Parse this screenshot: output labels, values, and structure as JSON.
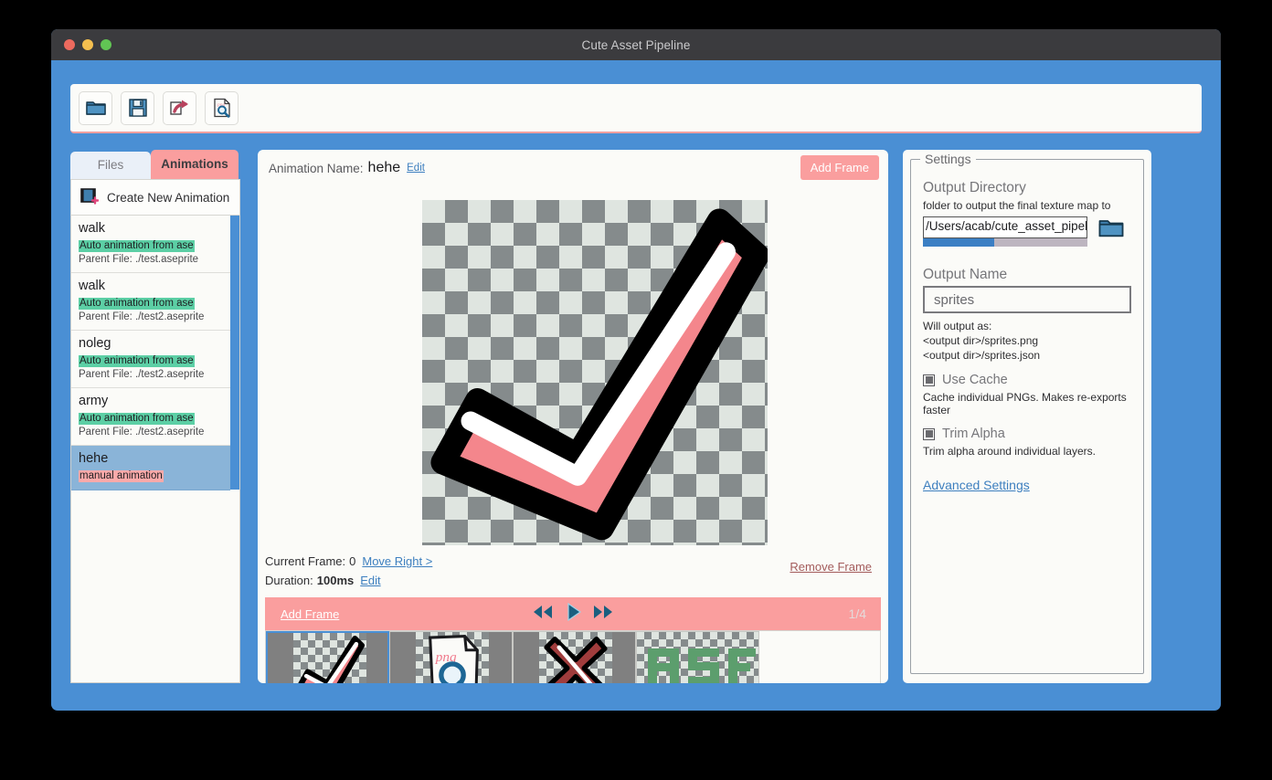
{
  "window": {
    "title": "Cute Asset Pipeline",
    "traffic_lights": [
      "close",
      "minimize",
      "maximize"
    ]
  },
  "toolbar": {
    "buttons": [
      {
        "name": "open-folder",
        "icon": "folder-icon"
      },
      {
        "name": "save",
        "icon": "floppy-disk-icon"
      },
      {
        "name": "export",
        "icon": "export-arrow-icon"
      },
      {
        "name": "preview-png",
        "icon": "png-search-icon"
      }
    ]
  },
  "sidebar": {
    "tabs": [
      {
        "label": "Files",
        "active": false
      },
      {
        "label": "Animations",
        "active": true
      }
    ],
    "create_new": {
      "label": "Create New Animation",
      "icon": "film-add-icon"
    },
    "animations": [
      {
        "name": "walk",
        "tag": "Auto animation from ase",
        "tag_type": "auto",
        "parent": "Parent File: ./test.aseprite",
        "selected": false
      },
      {
        "name": "walk",
        "tag": "Auto animation from ase",
        "tag_type": "auto",
        "parent": "Parent File: ./test2.aseprite",
        "selected": false
      },
      {
        "name": "noleg",
        "tag": "Auto animation from ase",
        "tag_type": "auto",
        "parent": "Parent File: ./test2.aseprite",
        "selected": false
      },
      {
        "name": "army",
        "tag": "Auto animation from ase",
        "tag_type": "auto",
        "parent": "Parent File: ./test2.aseprite",
        "selected": false
      },
      {
        "name": "hehe",
        "tag": "manual animation",
        "tag_type": "manual",
        "parent": "",
        "selected": true
      }
    ]
  },
  "main": {
    "animation_name_label": "Animation Name:",
    "animation_name_value": "hehe",
    "name_edit_link": "Edit",
    "add_frame_button": "Add Frame",
    "current_frame_label": "Current Frame:",
    "current_frame_value": "0",
    "move_right_link": "Move Right >",
    "duration_label": "Duration:",
    "duration_value": "100ms",
    "duration_edit_link": "Edit",
    "remove_frame_link": "Remove Frame",
    "playbar": {
      "add_frame_link": "Add Frame",
      "prev_icon": "rewind-icon",
      "play_icon": "play-icon",
      "next_icon": "fast-forward-icon",
      "counter": "1/4"
    },
    "frames": [
      {
        "name": "frame-checkmark",
        "art": "checkmark",
        "active": true
      },
      {
        "name": "frame-png-search",
        "art": "png-doc",
        "active": false
      },
      {
        "name": "frame-cross",
        "art": "cross",
        "active": false
      },
      {
        "name": "frame-ase-text",
        "art": "ase-text",
        "active": false
      }
    ]
  },
  "settings": {
    "legend": "Settings",
    "output_directory": {
      "heading": "Output Directory",
      "description": "folder to output the final texture map to",
      "value": "/Users/acab/cute_asset_pipelin",
      "browse_icon": "folder-icon"
    },
    "output_name": {
      "heading": "Output Name",
      "value": "sprites",
      "will_output_label": "Will output as:",
      "outputs": [
        "<output dir>/sprites.png",
        "<output dir>/sprites.json"
      ]
    },
    "use_cache": {
      "label": "Use Cache",
      "description": "Cache individual PNGs. Makes re-exports faster",
      "checked": true
    },
    "trim_alpha": {
      "label": "Trim Alpha",
      "description": "Trim alpha around individual layers.",
      "checked": true
    },
    "advanced_link": "Advanced Settings"
  },
  "colors": {
    "frame_blue": "#4a8fd4",
    "accent_pink": "#fa9e9e",
    "tag_green": "#5ccfa5",
    "tag_pink": "#fcaaaa",
    "selected_blue": "#8ab4d8",
    "link_blue": "#3d7fbf"
  }
}
